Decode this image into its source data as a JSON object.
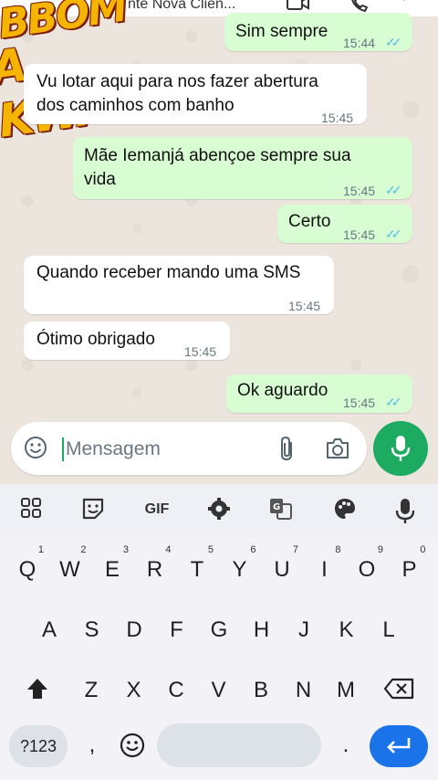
{
  "header": {
    "title": "nte Nova Clien...",
    "video_icon": "video-call-icon",
    "call_icon": "phone-icon",
    "menu_icon": "more-vert-icon"
  },
  "watermark": {
    "line1": "BBOM",
    "line2": "A KWAI"
  },
  "messages": [
    {
      "dir": "out",
      "text": "Sim sempre",
      "time": "15:44",
      "read": true
    },
    {
      "dir": "in",
      "text": "Vu lotar aqui para nos fazer abertura\ndos caminhos com banho",
      "time": "15:45"
    },
    {
      "dir": "out",
      "text": "Mãe Iemanjá abençoe sempre sua\nvida",
      "time": "15:45",
      "read": true
    },
    {
      "dir": "out",
      "text": "Certo",
      "time": "15:45",
      "read": true
    },
    {
      "dir": "in",
      "text": "Quando receber mando uma SMS",
      "time": "15:45"
    },
    {
      "dir": "in",
      "text": "Ótimo obrigado",
      "time": "15:45"
    },
    {
      "dir": "out",
      "text": "Ok aguardo",
      "time": "15:45",
      "read": true
    }
  ],
  "composer": {
    "placeholder": "Mensagem",
    "emoji_icon": "emoji-icon",
    "attach_icon": "paperclip-icon",
    "camera_icon": "camera-icon",
    "send_icon": "mic-icon"
  },
  "keyboard": {
    "toolbar": {
      "gif": "GIF"
    },
    "row1": [
      "Q",
      "W",
      "E",
      "R",
      "T",
      "Y",
      "U",
      "I",
      "O",
      "P"
    ],
    "row1_hints": [
      "1",
      "2",
      "3",
      "4",
      "5",
      "6",
      "7",
      "8",
      "9",
      "0"
    ],
    "row2": [
      "A",
      "S",
      "D",
      "F",
      "G",
      "H",
      "J",
      "K",
      "L"
    ],
    "row3": [
      "Z",
      "X",
      "C",
      "V",
      "B",
      "N",
      "M"
    ],
    "symbols_key": "?123",
    "comma": ",",
    "period": "."
  },
  "colors": {
    "outgoing_bubble": "#d9fdd3",
    "incoming_bubble": "#ffffff",
    "accent_green": "#1daa61",
    "read_ticks": "#53bdeb",
    "enter_key": "#1a73e8"
  }
}
